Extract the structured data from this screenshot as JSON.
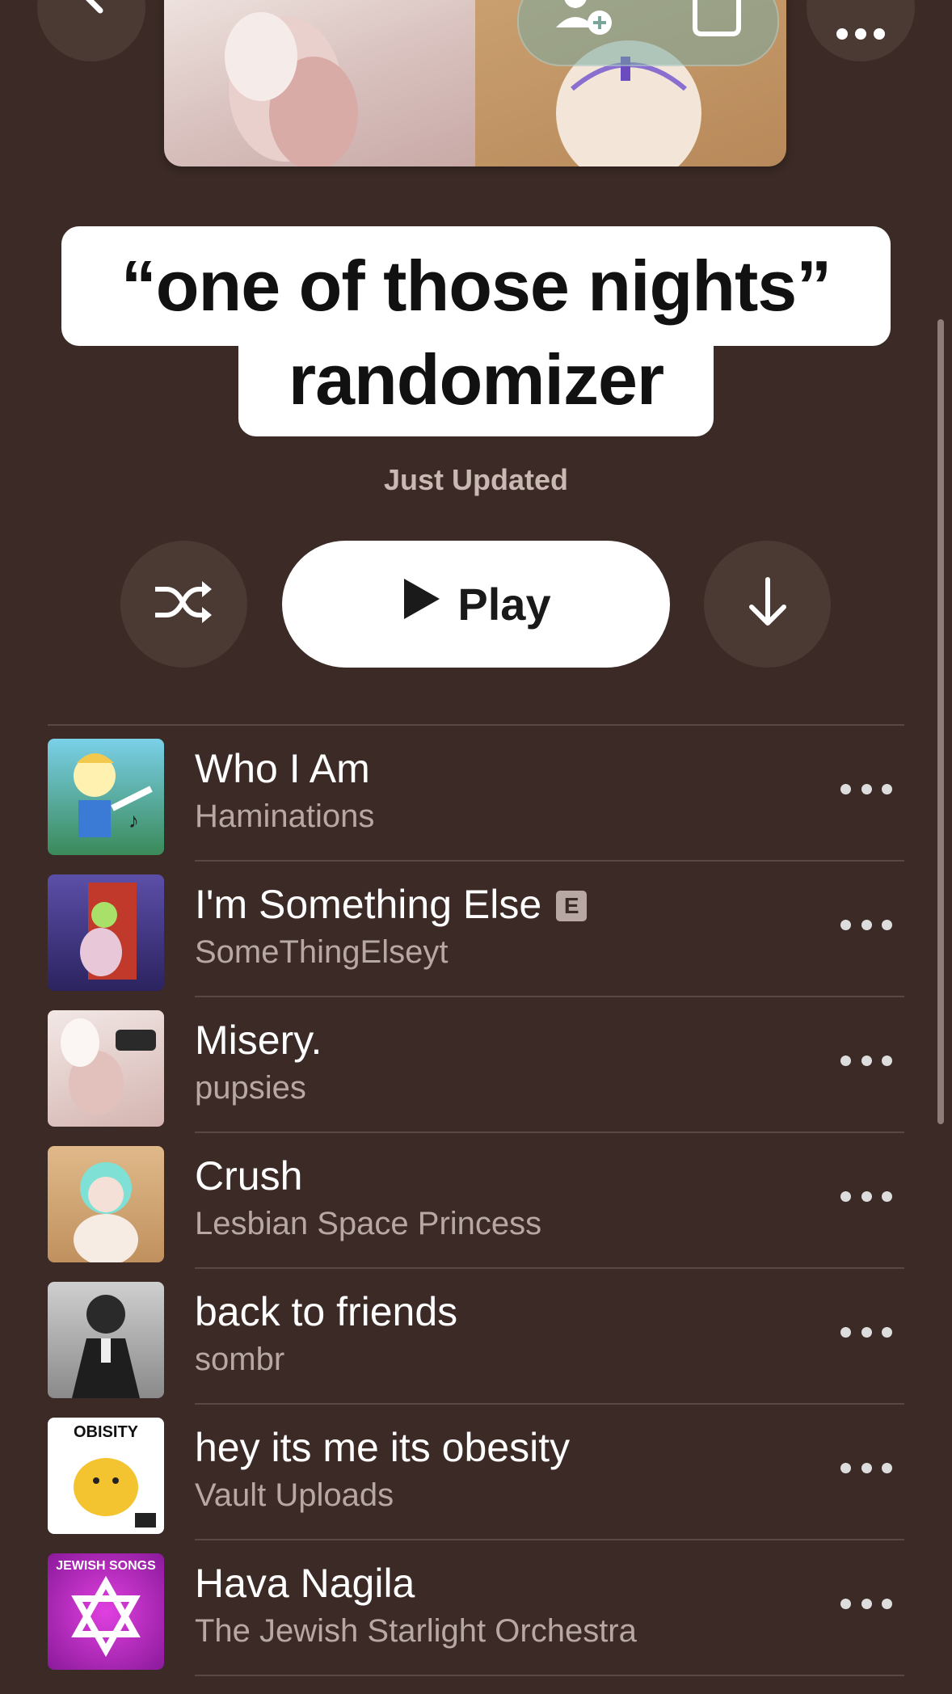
{
  "playlist": {
    "title_line1": "“one of those nights”",
    "title_line2": "randomizer",
    "status": "Just Updated"
  },
  "actions": {
    "play_label": "Play"
  },
  "colors": {
    "background": "#3b2a25",
    "button_bg": "#4b3a34",
    "secondary_text": "#b7a8a3"
  },
  "icons": {
    "back": "chevron-left-icon",
    "add_person": "person-add-icon",
    "share": "share-icon",
    "more": "ellipsis-icon",
    "shuffle": "shuffle-icon",
    "play": "play-icon",
    "download": "arrow-down-icon"
  },
  "tracks": [
    {
      "title": "Who I Am",
      "artist": "Haminations",
      "explicit": false
    },
    {
      "title": "I'm Something Else",
      "artist": "SomeThingElseyt",
      "explicit": true,
      "explicit_label": "E"
    },
    {
      "title": "Misery.",
      "artist": "pupsies",
      "explicit": false
    },
    {
      "title": "Crush",
      "artist": "Lesbian Space Princess",
      "explicit": false
    },
    {
      "title": "back to friends",
      "artist": "sombr",
      "explicit": false
    },
    {
      "title": "hey its me its obesity",
      "artist": "Vault Uploads",
      "explicit": false,
      "art_text": "OBISITY"
    },
    {
      "title": "Hava Nagila",
      "artist": "The Jewish Starlight Orchestra",
      "explicit": false,
      "art_text": "JEWISH SONGS"
    }
  ]
}
